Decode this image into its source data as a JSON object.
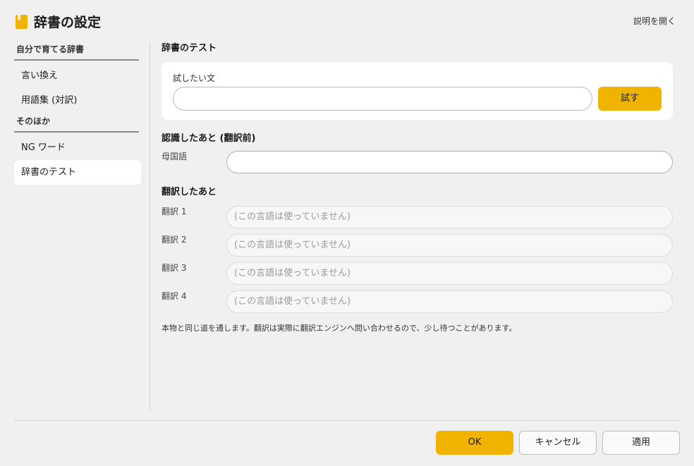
{
  "header": {
    "title": "辞書の設定",
    "help_link": "説明を開く",
    "icon": "book-icon"
  },
  "sidebar": {
    "sections": [
      {
        "label": "自分で育てる辞書",
        "items": [
          "言い換え",
          "用語集 (対訳)"
        ]
      },
      {
        "label": "そのほか",
        "items": [
          "NG ワード",
          "辞書のテスト"
        ]
      }
    ],
    "active_item": "辞書のテスト"
  },
  "main": {
    "test_section": {
      "title": "辞書のテスト",
      "input_label": "試したい文",
      "input_value": "",
      "button_label": "試す"
    },
    "recognized_section": {
      "title": "認識したあと (翻訳前)",
      "label": "母国語",
      "value": ""
    },
    "translated_section": {
      "title": "翻訳したあと",
      "rows": [
        {
          "label": "翻訳 1",
          "value": "(この言語は使っていません)"
        },
        {
          "label": "翻訳 2",
          "value": "(この言語は使っていません)"
        },
        {
          "label": "翻訳 3",
          "value": "(この言語は使っていません)"
        },
        {
          "label": "翻訳 4",
          "value": "(この言語は使っていません)"
        }
      ]
    },
    "note": "本物と同じ道を通します。翻訳は実際に翻訳エンジンへ問い合わせるので、少し待つことがあります。"
  },
  "footer": {
    "ok_label": "OK",
    "cancel_label": "キャンセル",
    "apply_label": "適用"
  },
  "colors": {
    "accent": "#f0b400",
    "background": "#f0f0f0",
    "card": "#ffffff"
  }
}
